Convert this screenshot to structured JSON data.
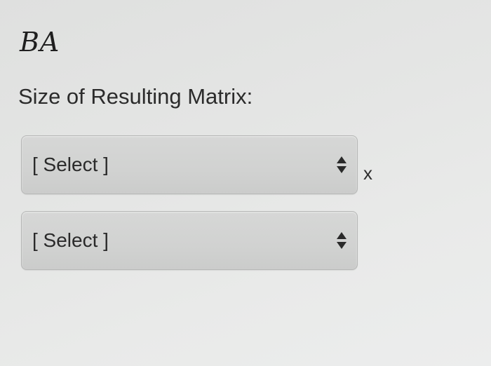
{
  "expression": "BA",
  "question": "Size of Resulting Matrix:",
  "rows_select": {
    "selected": "[ Select ]"
  },
  "cols_select": {
    "selected": "[ Select ]"
  },
  "multiply_symbol": "x",
  "icons": {
    "select_arrows": "up-down-arrows-icon"
  }
}
